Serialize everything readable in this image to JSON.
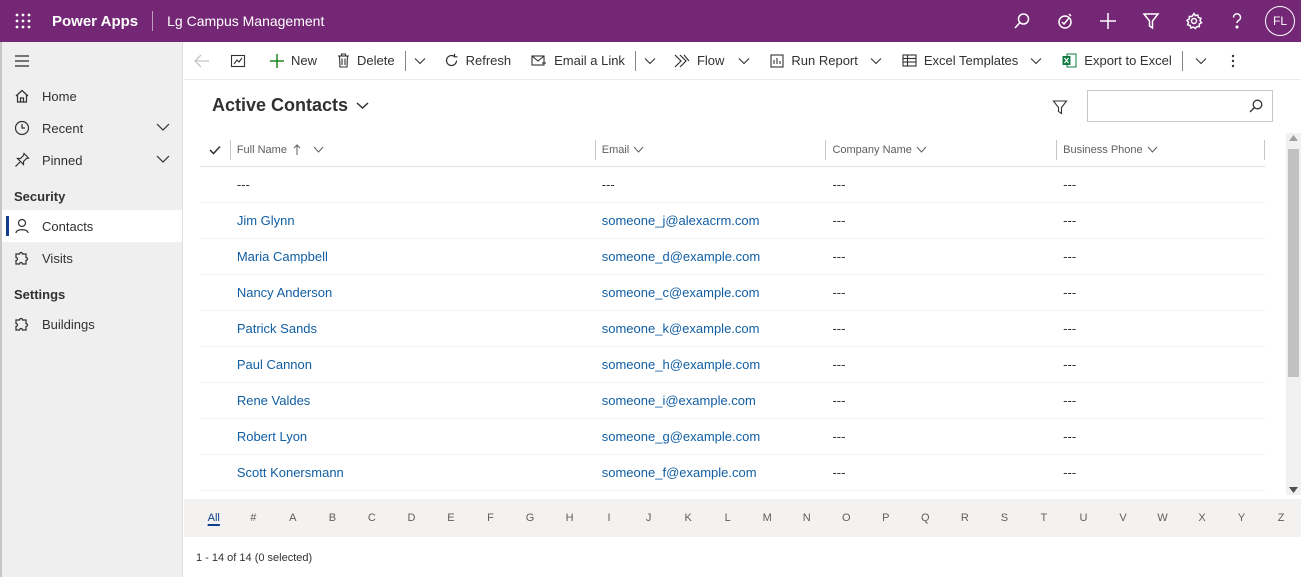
{
  "topbar": {
    "brand": "Power Apps",
    "app_name": "Lg Campus Management",
    "avatar_initials": "FL",
    "color": "#742774"
  },
  "nav": {
    "items_top": [
      {
        "label": "Home",
        "icon": "home-icon"
      },
      {
        "label": "Recent",
        "icon": "clock-icon"
      },
      {
        "label": "Pinned",
        "icon": "pin-icon"
      }
    ],
    "section_security": "Security",
    "security_items": [
      {
        "label": "Contacts",
        "icon": "person-icon",
        "active": true
      },
      {
        "label": "Visits",
        "icon": "puzzle-icon"
      }
    ],
    "section_settings": "Settings",
    "settings_items": [
      {
        "label": "Buildings",
        "icon": "puzzle-icon"
      }
    ]
  },
  "commands": {
    "new": "New",
    "delete": "Delete",
    "refresh": "Refresh",
    "email_link": "Email a Link",
    "flow": "Flow",
    "run_report": "Run Report",
    "excel_templates": "Excel Templates",
    "export_excel": "Export to Excel"
  },
  "view": {
    "title": "Active Contacts",
    "search_placeholder": ""
  },
  "grid": {
    "columns": [
      "Full Name",
      "Email",
      "Company Name",
      "Business Phone"
    ],
    "rows": [
      {
        "name": "---",
        "email": "---",
        "company": "---",
        "phone": "---"
      },
      {
        "name": "Jim Glynn",
        "email": "someone_j@alexacrm.com",
        "company": "---",
        "phone": "---"
      },
      {
        "name": "Maria Campbell",
        "email": "someone_d@example.com",
        "company": "---",
        "phone": "---"
      },
      {
        "name": "Nancy Anderson",
        "email": "someone_c@example.com",
        "company": "---",
        "phone": "---"
      },
      {
        "name": "Patrick Sands",
        "email": "someone_k@example.com",
        "company": "---",
        "phone": "---"
      },
      {
        "name": "Paul Cannon",
        "email": "someone_h@example.com",
        "company": "---",
        "phone": "---"
      },
      {
        "name": "Rene Valdes",
        "email": "someone_i@example.com",
        "company": "---",
        "phone": "---"
      },
      {
        "name": "Robert Lyon",
        "email": "someone_g@example.com",
        "company": "---",
        "phone": "---"
      },
      {
        "name": "Scott Konersmann",
        "email": "someone_f@example.com",
        "company": "---",
        "phone": "---"
      }
    ]
  },
  "alpha": [
    "All",
    "#",
    "A",
    "B",
    "C",
    "D",
    "E",
    "F",
    "G",
    "H",
    "I",
    "J",
    "K",
    "L",
    "M",
    "N",
    "O",
    "P",
    "Q",
    "R",
    "S",
    "T",
    "U",
    "V",
    "W",
    "X",
    "Y",
    "Z"
  ],
  "status": "1 - 14 of 14 (0 selected)"
}
